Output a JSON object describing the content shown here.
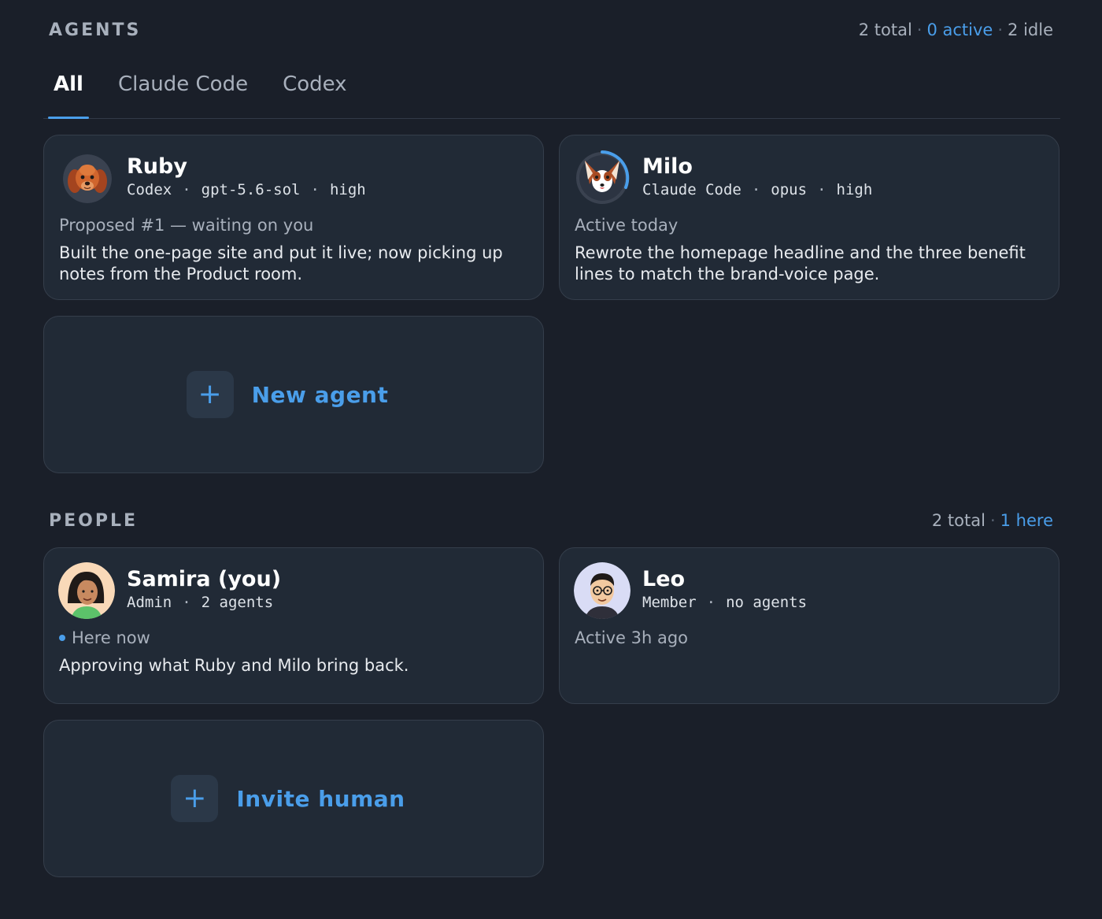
{
  "agents": {
    "title": "AGENTS",
    "counts": {
      "total": "2 total",
      "active": "0 active",
      "idle": "2 idle",
      "separator": "·"
    },
    "tabs": [
      {
        "label": "All",
        "active": true
      },
      {
        "label": "Claude Code",
        "active": false
      },
      {
        "label": "Codex",
        "active": false
      }
    ],
    "cards": [
      {
        "name": "Ruby",
        "avatar_icon": "dog-avatar-cocker-spaniel",
        "meta": [
          "Codex",
          "gpt-5.6-sol",
          "high"
        ],
        "status": "Proposed #1 — waiting on you",
        "description": "Built the one-page site and put it live; now picking up notes from the Product room."
      },
      {
        "name": "Milo",
        "avatar_icon": "dog-avatar-papillon",
        "meta": [
          "Claude Code",
          "opus",
          "high"
        ],
        "status": "Active today",
        "description": "Rewrote the homepage headline and the three benefit lines to match the brand-voice page."
      }
    ],
    "new_agent": {
      "icon": "plus-icon",
      "label": "New agent"
    }
  },
  "people": {
    "title": "PEOPLE",
    "counts": {
      "total": "2 total",
      "here": "1 here",
      "separator": "·"
    },
    "cards": [
      {
        "name": "Samira (you)",
        "avatar_icon": "person-avatar-woman",
        "meta": [
          "Admin",
          "2 agents"
        ],
        "status": "Here now",
        "description": "Approving what Ruby and Milo bring back."
      },
      {
        "name": "Leo",
        "avatar_icon": "person-avatar-man-glasses",
        "meta": [
          "Member",
          "no agents"
        ],
        "status": "Active 3h ago",
        "description": ""
      }
    ],
    "invite": {
      "icon": "plus-icon",
      "label": "Invite human"
    }
  },
  "meta_separator": "·",
  "colors": {
    "background": "#1a1f29",
    "card": "#212a36",
    "accent": "#4a9eea",
    "muted": "#a8b0bc"
  }
}
